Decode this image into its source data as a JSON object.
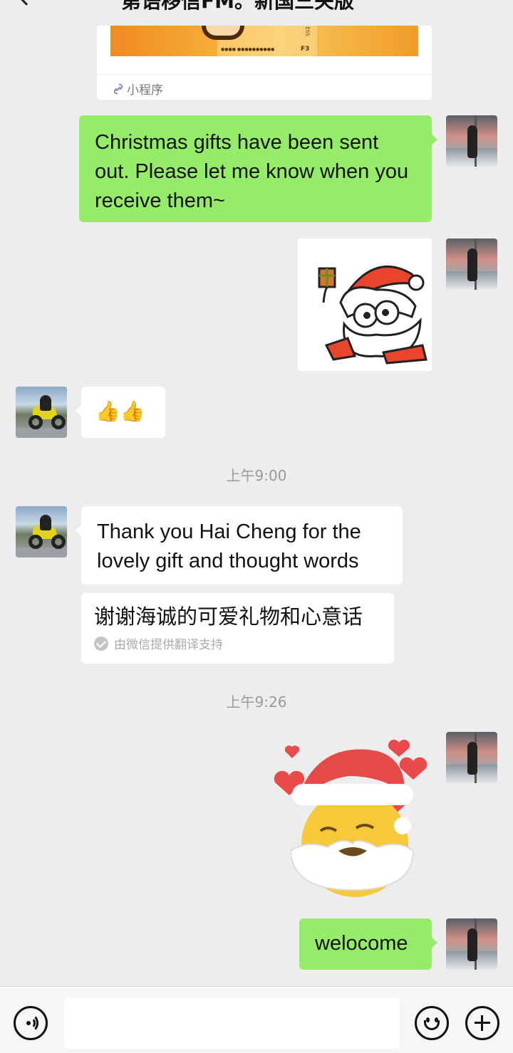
{
  "header": {
    "title": "第语移信FM。新国三关版"
  },
  "mini_program": {
    "label": "小程序",
    "card_code": "F3"
  },
  "messages": {
    "christmas": "Christmas gifts have been sent out. Please let me know when you receive them~",
    "thumbs": "👍👍",
    "time_1": "上午9:00",
    "thanks": "Thank you Hai Cheng for the lovely gift and thought words",
    "translation": "谢谢海诚的可爱礼物和心意话",
    "translation_note": "由微信提供翻译支持",
    "time_2": "上午9:26",
    "welcome": "welocome"
  },
  "input_bar": {
    "placeholder": ""
  },
  "colors": {
    "sent_bubble": "#95ec69",
    "received_bubble": "#ffffff",
    "background": "#ededed"
  }
}
